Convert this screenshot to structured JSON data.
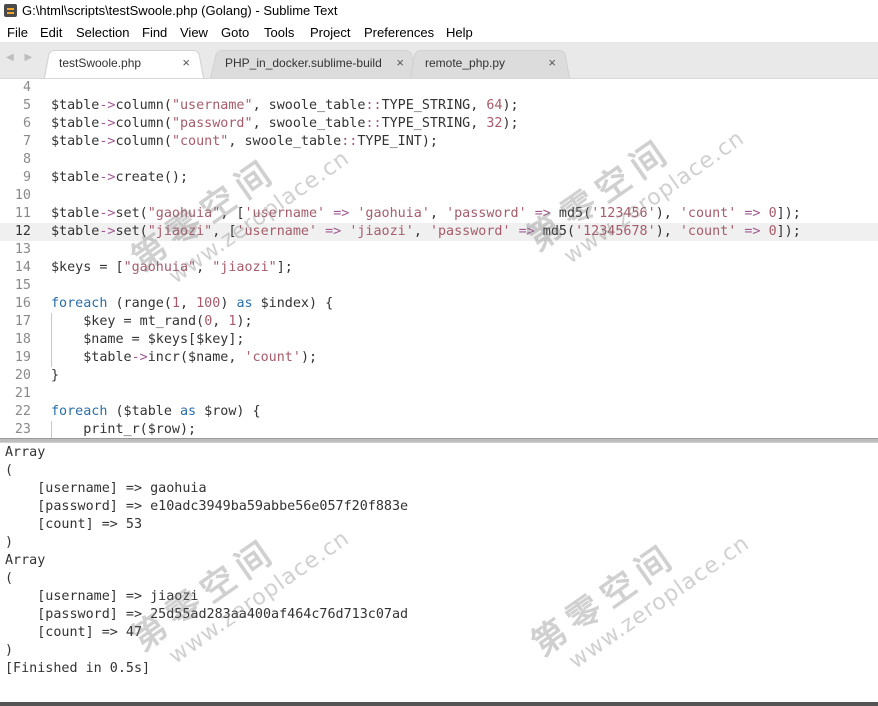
{
  "window": {
    "title": "G:\\html\\scripts\\testSwoole.php (Golang) - Sublime Text"
  },
  "menu": [
    "File",
    "Edit",
    "Selection",
    "Find",
    "View",
    "Goto",
    "Tools",
    "Project",
    "Preferences",
    "Help"
  ],
  "tabs": [
    {
      "label": "testSwoole.php",
      "close": "×",
      "active": true
    },
    {
      "label": "PHP_in_docker.sublime-build",
      "close": "×",
      "active": false
    },
    {
      "label": "remote_php.py",
      "close": "×",
      "active": false
    }
  ],
  "tab_nav": "◀ ▶",
  "editor": {
    "current_line": 12,
    "lines": [
      {
        "n": "4",
        "code": ""
      },
      {
        "n": "5",
        "code": "$table->column(\"username\", swoole_table::TYPE_STRING, 64);"
      },
      {
        "n": "6",
        "code": "$table->column(\"password\", swoole_table::TYPE_STRING, 32);"
      },
      {
        "n": "7",
        "code": "$table->column(\"count\", swoole_table::TYPE_INT);"
      },
      {
        "n": "8",
        "code": ""
      },
      {
        "n": "9",
        "code": "$table->create();"
      },
      {
        "n": "10",
        "code": ""
      },
      {
        "n": "11",
        "code": "$table->set(\"gaohuia\", ['username' => 'gaohuia', 'password' => md5('123456'), 'count' => 0]);"
      },
      {
        "n": "12",
        "code": "$table->set(\"jiaozi\", ['username' => 'jiaozi', 'password' => md5('12345678'), 'count' => 0]);"
      },
      {
        "n": "13",
        "code": ""
      },
      {
        "n": "14",
        "code": "$keys = [\"gaohuia\", \"jiaozi\"];"
      },
      {
        "n": "15",
        "code": ""
      },
      {
        "n": "16",
        "code": "foreach (range(1, 100) as $index) {"
      },
      {
        "n": "17",
        "code": "    $key = mt_rand(0, 1);"
      },
      {
        "n": "18",
        "code": "    $name = $keys[$key];"
      },
      {
        "n": "19",
        "code": "    $table->incr($name, 'count');"
      },
      {
        "n": "20",
        "code": "}"
      },
      {
        "n": "21",
        "code": ""
      },
      {
        "n": "22",
        "code": "foreach ($table as $row) {"
      },
      {
        "n": "23",
        "code": "    print_r($row);"
      }
    ]
  },
  "output": {
    "lines": [
      "Array",
      "(",
      "    [username] => gaohuia",
      "    [password] => e10adc3949ba59abbe56e057f20f883e",
      "    [count] => 53",
      ")",
      "Array",
      "(",
      "    [username] => jiaozi",
      "    [password] => 25d55ad283aa400af464c76d713c07ad",
      "    [count] => 47",
      ")",
      "[Finished in 0.5s]"
    ]
  },
  "watermark": {
    "cn": "第零空间",
    "en": "www.zeroplace.cn"
  },
  "colors": {
    "string": "#a65c6a",
    "keyword": "#2a6ea8",
    "operator": "#a05890",
    "current_line_bg": "#f0f0f0"
  }
}
